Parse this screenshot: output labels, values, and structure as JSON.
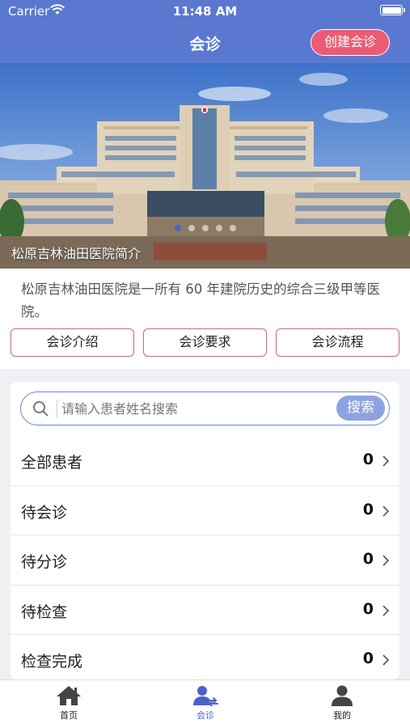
{
  "status_bar": {
    "carrier": "Carrier",
    "time": "11:48 AM"
  },
  "header": {
    "title": "会诊",
    "create_button": "创建会诊"
  },
  "banner": {
    "caption": "松原吉林油田医院简介",
    "slide_count": 5,
    "active_slide": 1
  },
  "intro": {
    "text": "松原吉林油田医院是一所有 60 年建院历史的综合三级甲等医院。",
    "buttons": [
      "会诊介绍",
      "会诊要求",
      "会诊流程"
    ]
  },
  "search": {
    "placeholder": "请输入患者姓名搜索",
    "value": "",
    "button": "搜索"
  },
  "patient_list": [
    {
      "label": "全部患者",
      "count": "0"
    },
    {
      "label": "待会诊",
      "count": "0"
    },
    {
      "label": "待分诊",
      "count": "0"
    },
    {
      "label": "待检查",
      "count": "0"
    },
    {
      "label": "检查完成",
      "count": "0"
    }
  ],
  "tabbar": [
    {
      "label": "首页",
      "icon": "home-icon",
      "active": false
    },
    {
      "label": "会诊",
      "icon": "consult-icon",
      "active": true
    },
    {
      "label": "我的",
      "icon": "user-icon",
      "active": false
    }
  ],
  "colors": {
    "primary": "#5b78d1",
    "accent": "#ec5b73",
    "button_border": "#d8637a",
    "tab_active": "#4a63c8"
  }
}
